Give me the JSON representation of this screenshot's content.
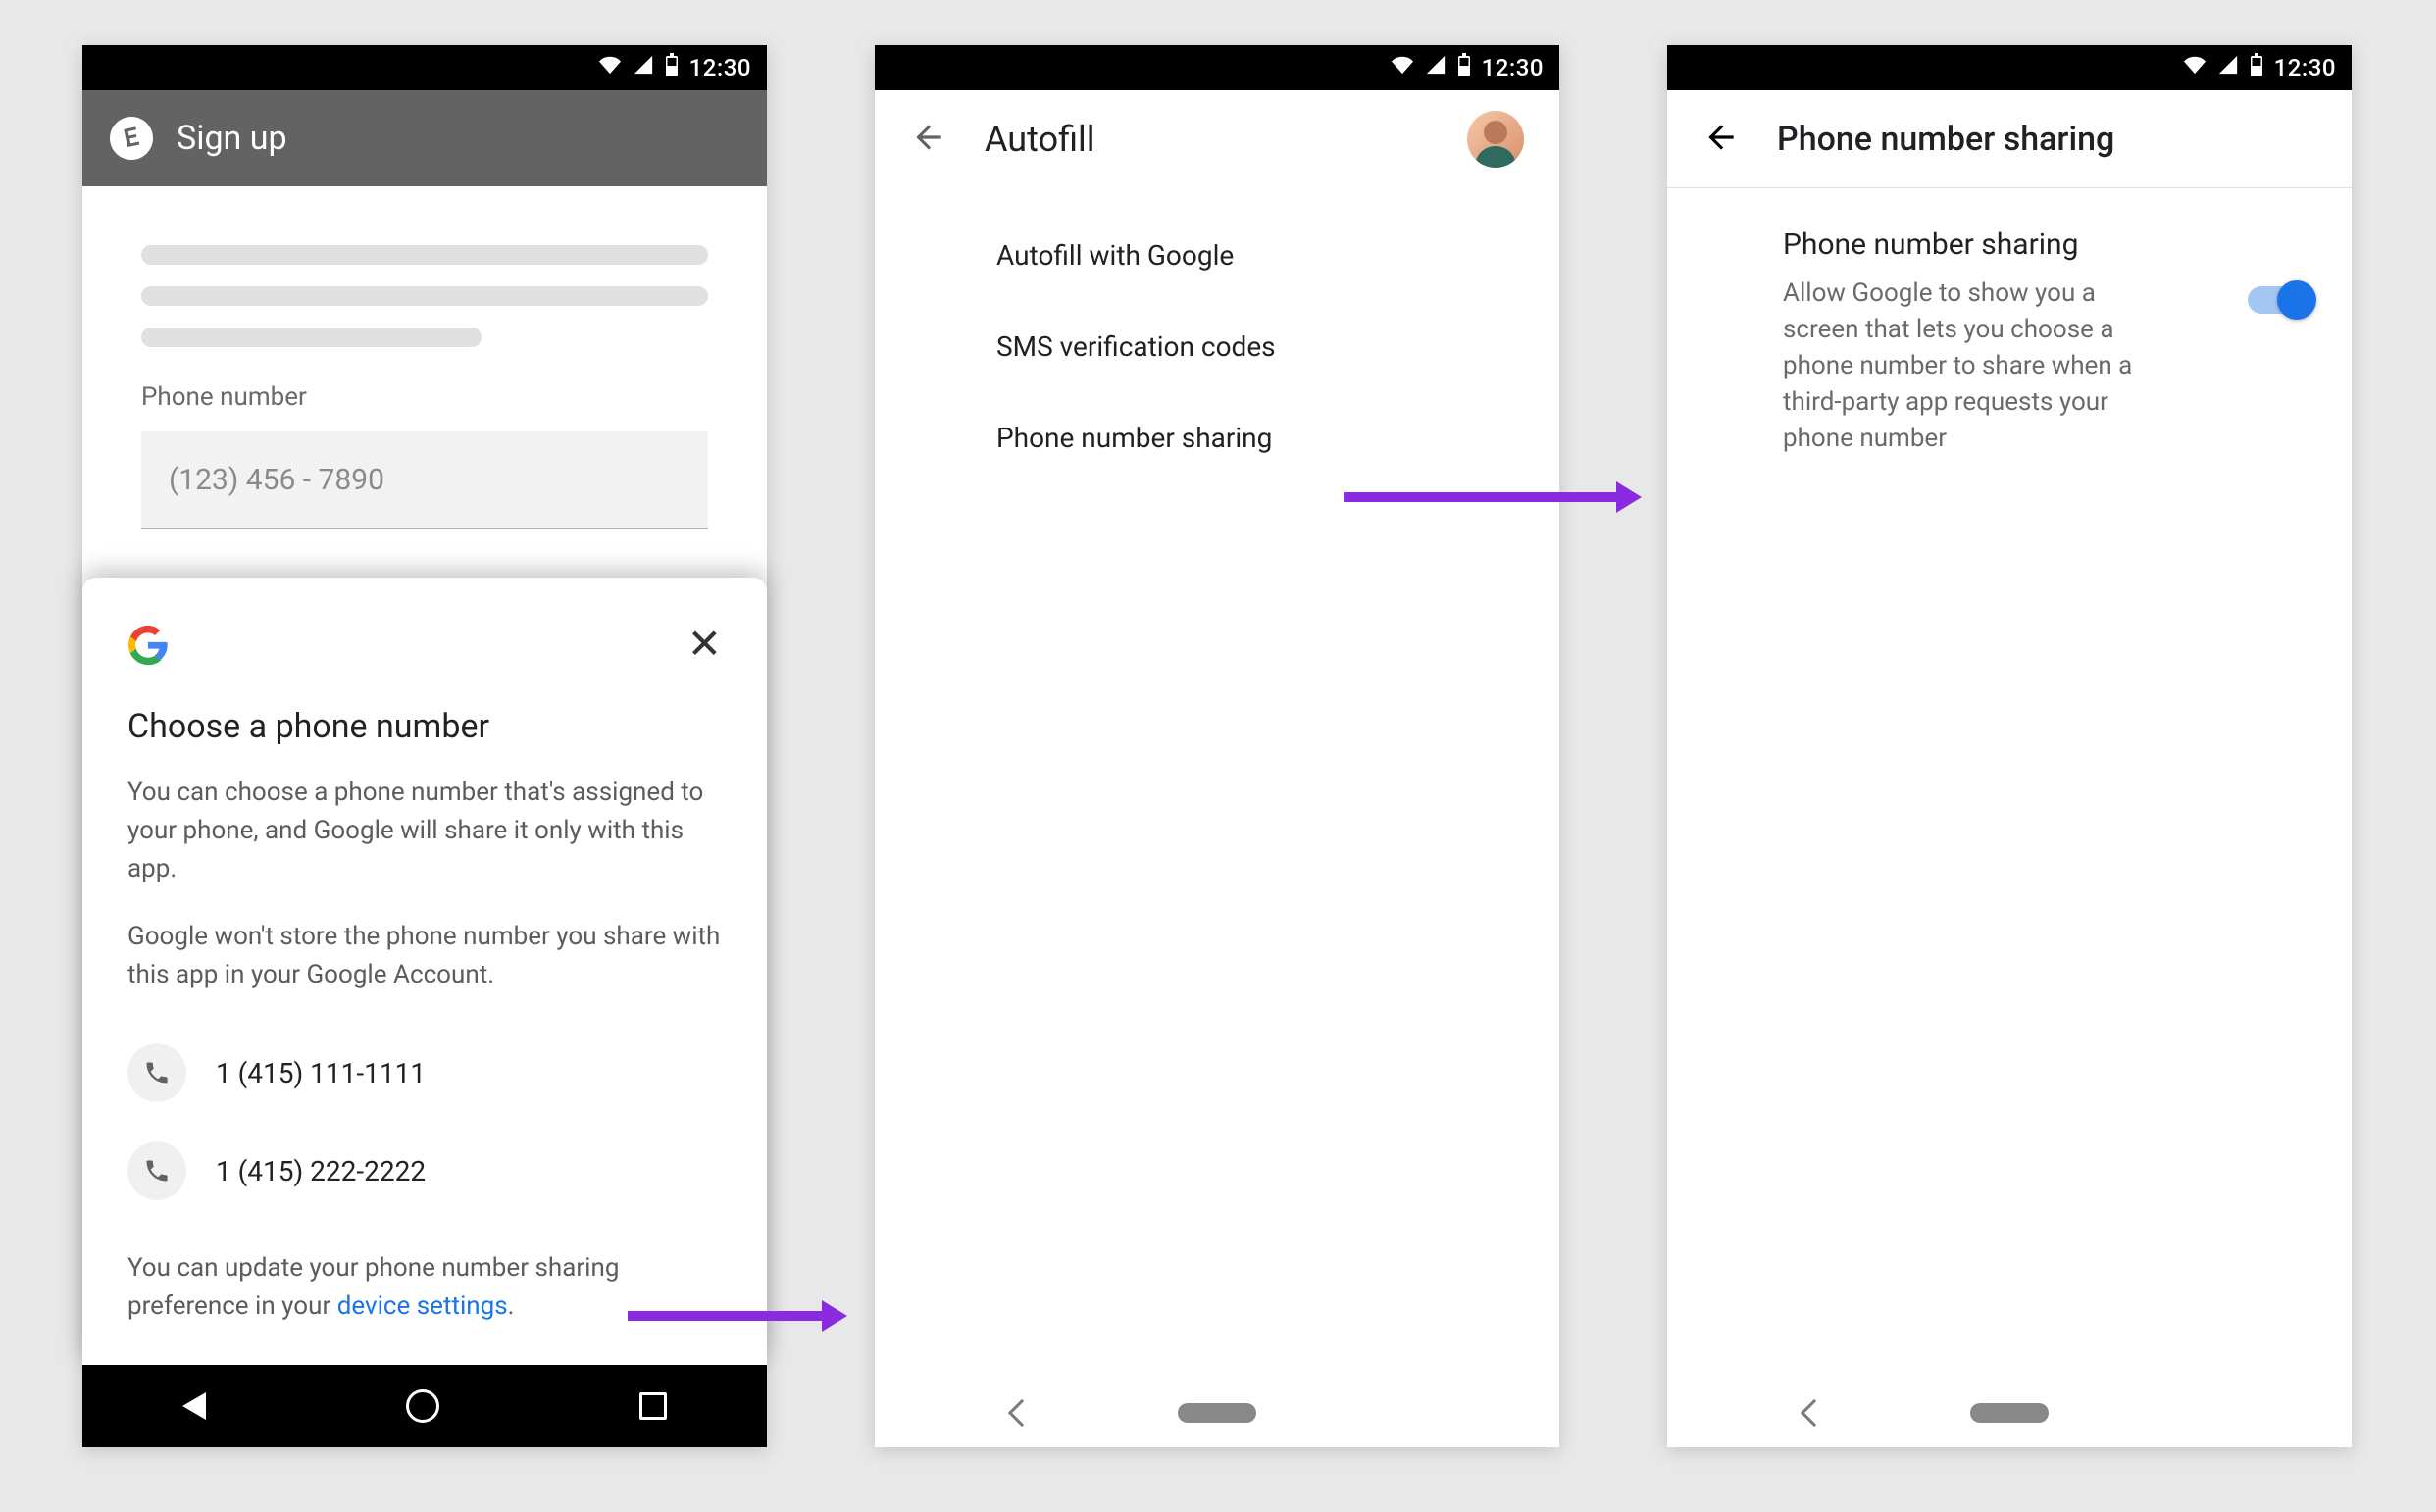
{
  "status_bar": {
    "time": "12:30"
  },
  "phone1": {
    "header": {
      "logo_letter": "E",
      "title": "Sign up"
    },
    "form": {
      "label": "Phone number",
      "placeholder": "(123) 456 - 7890"
    },
    "sheet": {
      "title": "Choose a phone number",
      "para1": "You can choose a phone number that's assigned to your phone, and Google will share it only with this app.",
      "para2": "Google won't store the phone number you share with this app in your Google Account.",
      "numbers": [
        "1 (415) 111-1111",
        "1 (415) 222-2222"
      ],
      "footer_prefix": "You can update your phone number sharing preference in your ",
      "footer_link": "device settings",
      "footer_suffix": "."
    }
  },
  "phone2": {
    "title": "Autofill",
    "items": [
      "Autofill with Google",
      "SMS verification codes",
      "Phone number sharing"
    ]
  },
  "phone3": {
    "title": "Phone number sharing",
    "setting_title": "Phone number sharing",
    "setting_desc": "Allow Google to show you a screen that lets you choose a phone number to share when a third-party app requests your phone number"
  }
}
